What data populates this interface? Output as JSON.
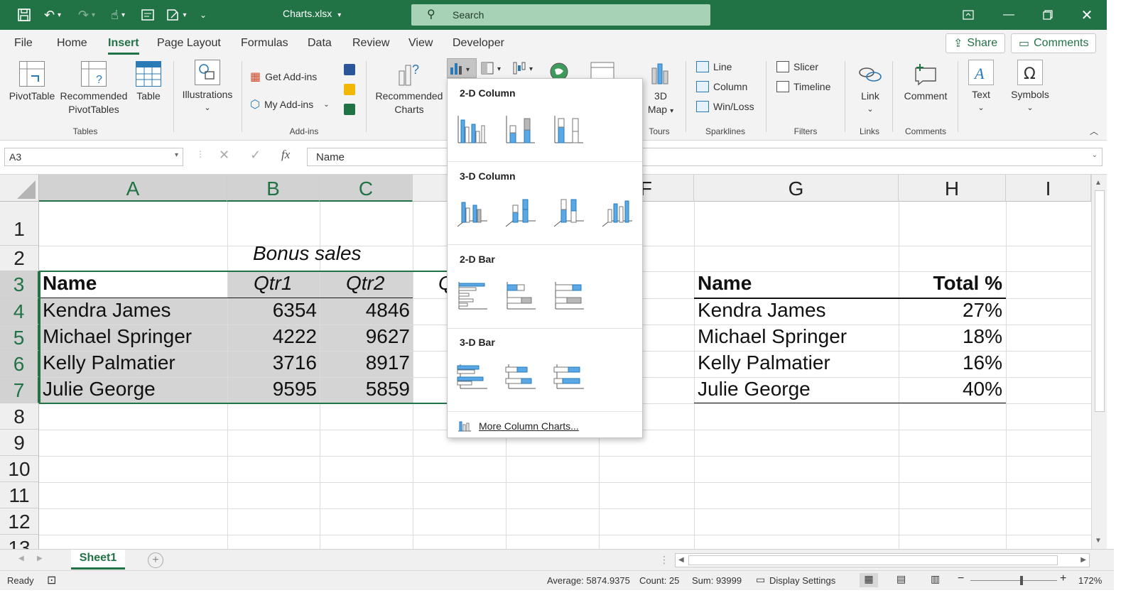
{
  "window": {
    "filename": "Charts.xlsx",
    "search_placeholder": "Search"
  },
  "tabs": [
    "File",
    "Home",
    "Insert",
    "Page Layout",
    "Formulas",
    "Data",
    "Review",
    "View",
    "Developer"
  ],
  "active_tab": "Insert",
  "share_label": "Share",
  "comments_label": "Comments",
  "ribbon": {
    "pivottable": "PivotTable",
    "recommended_pivottables_1": "Recommended",
    "recommended_pivottables_2": "PivotTables",
    "table": "Table",
    "tables_group": "Tables",
    "illustrations": "Illustrations",
    "get_addins": "Get Add-ins",
    "my_addins": "My Add-ins",
    "addins_group": "Add-ins",
    "recommended_charts_1": "Recommended",
    "recommended_charts_2": "Charts",
    "map_1": "3D",
    "map_2": "Map",
    "tours_group": "Tours",
    "line": "Line",
    "column": "Column",
    "winloss": "Win/Loss",
    "sparklines_group": "Sparklines",
    "slicer": "Slicer",
    "timeline": "Timeline",
    "filters_group": "Filters",
    "link": "Link",
    "links_group": "Links",
    "comment": "Comment",
    "comments_group": "Comments",
    "text": "Text",
    "symbols": "Symbols"
  },
  "formula_bar": {
    "name_box": "A3",
    "fx": "fx",
    "formula": "Name"
  },
  "columns": [
    "A",
    "B",
    "C",
    "F",
    "G",
    "H",
    "I"
  ],
  "rows": [
    "1",
    "2",
    "3",
    "4",
    "5",
    "6",
    "7",
    "8",
    "9",
    "10",
    "11",
    "12",
    "13"
  ],
  "sheet": {
    "title": "Bonus sales",
    "headers": [
      "Name",
      "Qtr1",
      "Qtr2",
      "Q"
    ],
    "data": [
      {
        "name": "Kendra James",
        "q1": "6354",
        "q2": "4846"
      },
      {
        "name": "Michael Springer",
        "q1": "4222",
        "q2": "9627"
      },
      {
        "name": "Kelly Palmatier",
        "q1": "3716",
        "q2": "8917"
      },
      {
        "name": "Julie George",
        "q1": "9595",
        "q2": "5859"
      }
    ],
    "summary_headers": [
      "Name",
      "Total %"
    ],
    "summary": [
      {
        "name": "Kendra James",
        "pct": "27%"
      },
      {
        "name": "Michael Springer",
        "pct": "18%"
      },
      {
        "name": "Kelly Palmatier",
        "pct": "16%"
      },
      {
        "name": "Julie George",
        "pct": "40%"
      }
    ]
  },
  "dropdown": {
    "section_2d_column": "2-D Column",
    "section_3d_column": "3-D Column",
    "section_2d_bar": "2-D Bar",
    "section_3d_bar": "3-D Bar",
    "more": "More Column Charts..."
  },
  "sheet_tab": "Sheet1",
  "status": {
    "ready": "Ready",
    "average": "Average: 5874.9375",
    "count": "Count: 25",
    "sum": "Sum: 93999",
    "display_settings": "Display Settings",
    "zoom": "172%"
  },
  "colors": {
    "excel_green": "#217346",
    "chart_blue": "#5aa8e6",
    "chart_gray": "#b8b8b8"
  }
}
